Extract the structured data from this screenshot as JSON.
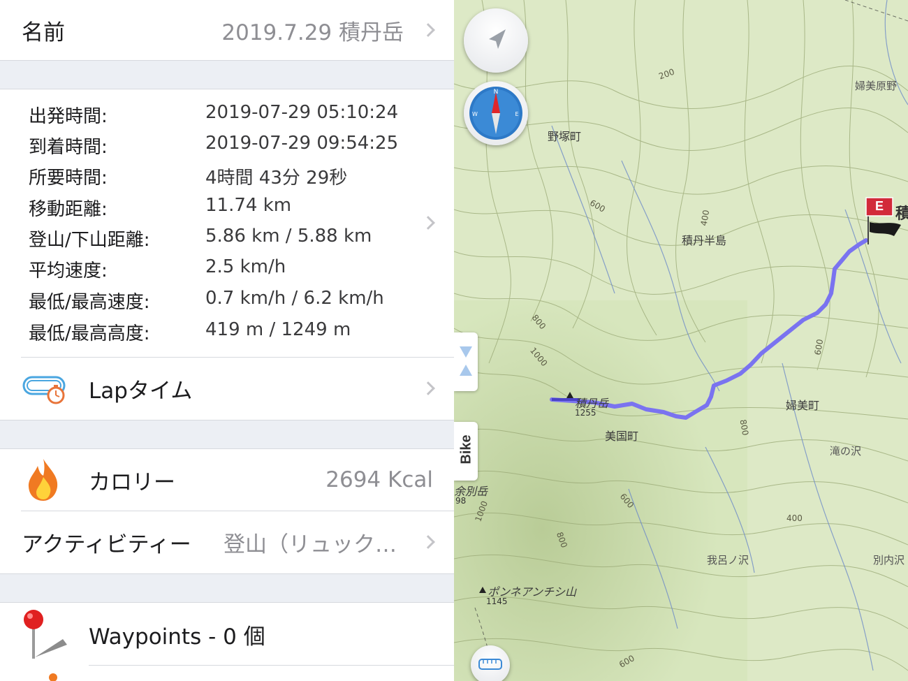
{
  "details": {
    "name_label": "名前",
    "name_value": "2019.7.29 積丹岳",
    "stats": [
      {
        "key": "出発時間:",
        "value": "2019-07-29 05:10:24"
      },
      {
        "key": "到着時間:",
        "value": "2019-07-29 09:54:25"
      },
      {
        "key": "所要時間:",
        "value": "4時間 43分 29秒"
      },
      {
        "key": "移動距離:",
        "value": "11.74 km"
      },
      {
        "key": "登山/下山距離:",
        "value": "5.86 km / 5.88 km"
      },
      {
        "key": "平均速度:",
        "value": "2.5 km/h"
      },
      {
        "key": "最低/最高速度:",
        "value": "0.7 km/h / 6.2 km/h"
      },
      {
        "key": "最低/最高高度:",
        "value": "419 m / 1249 m"
      }
    ],
    "lap_label": "Lapタイム",
    "calorie_label": "カロリー",
    "calorie_value": "2694 Kcal",
    "activity_label": "アクティビティー",
    "activity_value": "登山（リュック…",
    "waypoints_label": "Waypoints - 0 個"
  },
  "map": {
    "bike_tab": "Bike",
    "end_flag": "E",
    "place_labels": {
      "nozuka": "野塚町",
      "hanami_genya": "婦美原野",
      "shakotan_hanto": "積丹半島",
      "shakotan_dake": "積丹岳",
      "shakotan_dake_elev": "1255",
      "mikuni": "美国町",
      "fumi": "婦美町",
      "taki_no_sawa": "滝の沢",
      "yobetsu": "余別岳",
      "yobetsu_elev": "98",
      "gaoro": "我呂ノ沢",
      "betsunai": "別内沢",
      "ponne": "ポンネアンチシ山",
      "ponne_elev": "1145",
      "shaku_edge": "積"
    },
    "contour_labels": {
      "c200": "200",
      "c600a": "600",
      "c400": "400",
      "c800a": "800",
      "c1000a": "1000",
      "c600b": "600",
      "c800b": "800",
      "c1000b": "1000",
      "c600c": "600",
      "c400b": "400",
      "c800c": "800",
      "c600d": "600"
    },
    "colors": {
      "track": "#7a73f0",
      "terrain": "#d7e6bd",
      "end_flag": "#d22a3a"
    }
  }
}
